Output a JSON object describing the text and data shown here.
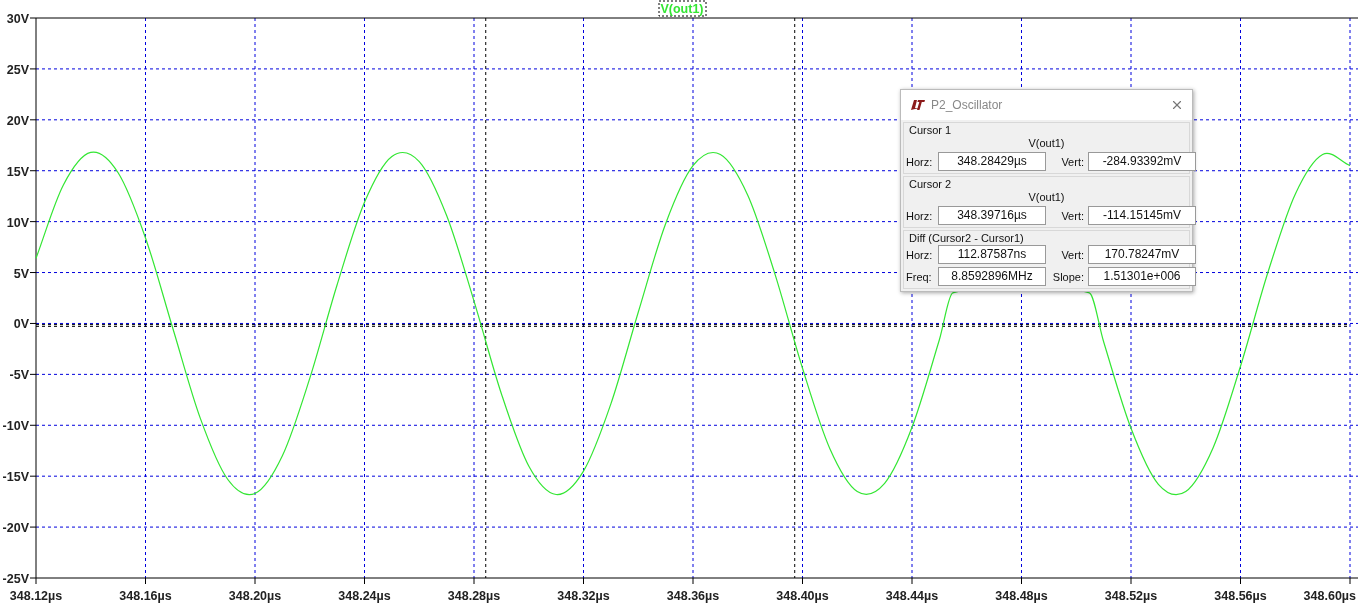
{
  "plot": {
    "chart_data": {
      "type": "line",
      "grid": true,
      "x": [
        348.12,
        348.13,
        348.14,
        348.15,
        348.16,
        348.17,
        348.18,
        348.19,
        348.2,
        348.21,
        348.22,
        348.23,
        348.24,
        348.25,
        348.26,
        348.27,
        348.28,
        348.29,
        348.3,
        348.31,
        348.32,
        348.33,
        348.34,
        348.35,
        348.36,
        348.37,
        348.38,
        348.39,
        348.4,
        348.41,
        348.42,
        348.43,
        348.44,
        348.45,
        348.4549,
        348.5048,
        348.51,
        348.52,
        348.53,
        348.54,
        348.55,
        348.56,
        348.57,
        348.58,
        348.59,
        348.6
      ],
      "series": [
        {
          "name": "V(out1)",
          "color": "#33e633",
          "values": [
            6.4,
            13.6,
            16.8,
            14.8,
            8.4,
            -0.5,
            -9.3,
            -15.3,
            -16.7,
            -13.0,
            -5.4,
            3.8,
            11.9,
            16.4,
            15.9,
            10.6,
            2.2,
            -6.9,
            -14.0,
            -16.8,
            -14.5,
            -7.9,
            1.1,
            9.8,
            15.5,
            16.6,
            12.6,
            4.8,
            -4.4,
            -12.3,
            -16.5,
            -15.7,
            -10.2,
            -1.6,
            3.0,
            3.0,
            -1.8,
            -10.3,
            -15.8,
            -16.5,
            -12.2,
            -4.2,
            5.0,
            12.7,
            16.6,
            15.5
          ]
        }
      ],
      "xlim": [
        348.12,
        348.6
      ],
      "ylim": [
        -25,
        30
      ],
      "xticks": [
        {
          "value": 348.12,
          "label": "348.12µs"
        },
        {
          "value": 348.16,
          "label": "348.16µs"
        },
        {
          "value": 348.2,
          "label": "348.20µs"
        },
        {
          "value": 348.24,
          "label": "348.24µs"
        },
        {
          "value": 348.28,
          "label": "348.28µs"
        },
        {
          "value": 348.32,
          "label": "348.32µs"
        },
        {
          "value": 348.36,
          "label": "348.36µs"
        },
        {
          "value": 348.4,
          "label": "348.40µs"
        },
        {
          "value": 348.44,
          "label": "348.44µs"
        },
        {
          "value": 348.48,
          "label": "348.48µs"
        },
        {
          "value": 348.52,
          "label": "348.52µs"
        },
        {
          "value": 348.56,
          "label": "348.56µs"
        },
        {
          "value": 348.6,
          "label": "348.60µs"
        }
      ],
      "yticks": [
        {
          "value": 30,
          "label": "30V"
        },
        {
          "value": 25,
          "label": "25V"
        },
        {
          "value": 20,
          "label": "20V"
        },
        {
          "value": 15,
          "label": "15V"
        },
        {
          "value": 10,
          "label": "10V"
        },
        {
          "value": 5,
          "label": "5V"
        },
        {
          "value": 0,
          "label": "0V"
        },
        {
          "value": -5,
          "label": "-5V"
        },
        {
          "value": -10,
          "label": "-10V"
        },
        {
          "value": -15,
          "label": "-15V"
        },
        {
          "value": -20,
          "label": "-20V"
        },
        {
          "value": -25,
          "label": "-25V"
        }
      ]
    }
  },
  "dialog": {
    "title": "P2_Oscillator",
    "groups": [
      {
        "title": "Cursor 1",
        "trace": "V(out1)",
        "fields": [
          {
            "label": "Horz:",
            "value": "348.28429µs"
          },
          {
            "label": "Vert:",
            "value": "-284.93392mV"
          }
        ]
      },
      {
        "title": "Cursor 2",
        "trace": "V(out1)",
        "fields": [
          {
            "label": "Horz:",
            "value": "348.39716µs"
          },
          {
            "label": "Vert:",
            "value": "-114.15145mV"
          }
        ]
      },
      {
        "title": "Diff (Cursor2 - Cursor1)",
        "fields": [
          {
            "label": "Horz:",
            "value": "112.87587ns"
          },
          {
            "label": "Vert:",
            "value": "170.78247mV"
          },
          {
            "label": "Freq:",
            "value": "8.8592896MHz"
          },
          {
            "label": "Slope:",
            "value": "1.51301e+006"
          }
        ]
      }
    ]
  }
}
